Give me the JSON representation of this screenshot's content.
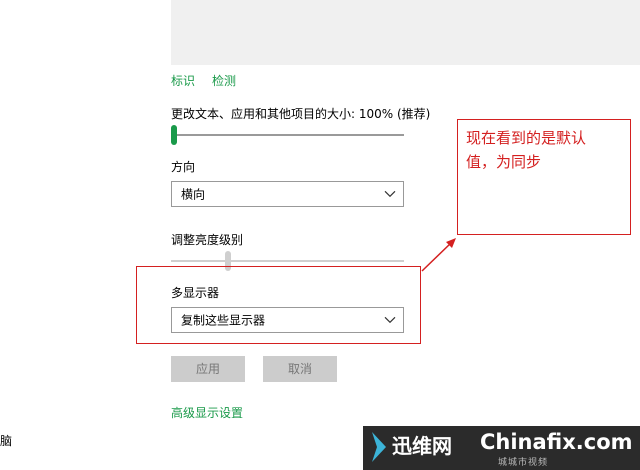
{
  "links": {
    "identify": "标识",
    "detect": "检测",
    "advanced": "高级显示设置"
  },
  "scale": {
    "label": "更改文本、应用和其他项目的大小: 100% (推荐)",
    "level": 0.0
  },
  "orientation": {
    "label": "方向",
    "value": "横向"
  },
  "brightness": {
    "label": "调整亮度级别",
    "level": 0.24,
    "state": "disabled"
  },
  "multi_display": {
    "label": "多显示器",
    "value": "复制这些显示器"
  },
  "buttons": {
    "apply": "应用",
    "cancel": "取消"
  },
  "sidebar": {
    "partial_item": "脑"
  },
  "annotation": {
    "line1": "现在看到的是默认",
    "line2": "值，为同步"
  },
  "watermark": {
    "cn": "迅维网",
    "en": "Chinafix.com",
    "sub": "城城市视频"
  },
  "colors": {
    "accent": "#1a9a4a",
    "annotation": "#d42020",
    "watermark_bg": "#2b2b2b"
  },
  "icons": {
    "dropdown": "chevron-down-icon",
    "brand": "chevron-right-icon"
  }
}
